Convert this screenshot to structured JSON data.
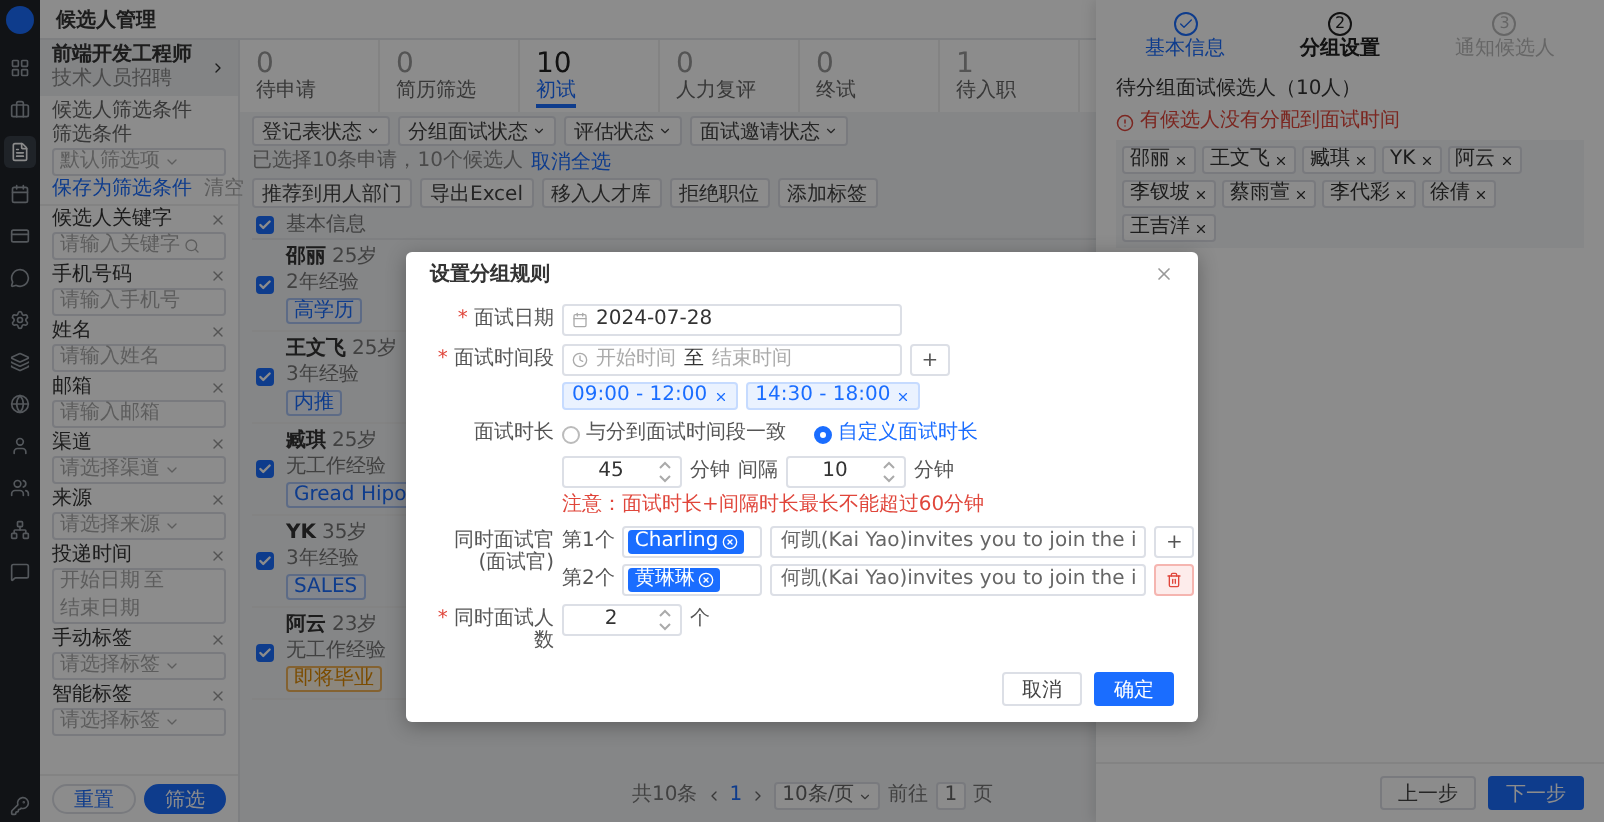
{
  "app": {
    "title": "候选人管理"
  },
  "nav_items": [
    {
      "selected": false
    },
    {
      "selected": false
    },
    {
      "selected": true
    },
    {
      "selected": false
    },
    {
      "selected": false
    },
    {
      "selected": false
    },
    {
      "selected": false
    },
    {
      "selected": false
    },
    {
      "selected": false
    },
    {
      "selected": false
    },
    {
      "selected": false
    },
    {
      "selected": false
    },
    {
      "selected": false
    }
  ],
  "position": {
    "title": "前端开发工程师",
    "subtitle": "技术人员招聘"
  },
  "filters": {
    "section_title": "候选人筛选条件",
    "preset_label": "筛选条件",
    "preset_value": "默认筛选项",
    "save_link": "保存为筛选条件",
    "clear_link": "清空",
    "groups": [
      {
        "label": "候选人关键字",
        "kind": "search",
        "placeholder": "请输入关键字"
      },
      {
        "label": "手机号码",
        "kind": "text",
        "placeholder": "请输入手机号"
      },
      {
        "label": "姓名",
        "kind": "text",
        "placeholder": "请输入姓名"
      },
      {
        "label": "邮箱",
        "kind": "text",
        "placeholder": "请输入邮箱"
      },
      {
        "label": "渠道",
        "kind": "select",
        "placeholder": "请选择渠道"
      },
      {
        "label": "来源",
        "kind": "select",
        "placeholder": "请选择来源"
      },
      {
        "label": "投递时间",
        "kind": "daterange",
        "placeholder": "开始日期",
        "separator": "至",
        "end_placeholder": "结束日期"
      },
      {
        "label": "手动标签",
        "kind": "select",
        "placeholder": "请选择标签"
      },
      {
        "label": "智能标签",
        "kind": "select",
        "placeholder": "请选择标签"
      }
    ],
    "reset": "重置",
    "apply": "筛选"
  },
  "stages": [
    {
      "count": "0",
      "label": "待申请",
      "selected": false
    },
    {
      "count": "0",
      "label": "简历筛选",
      "selected": false
    },
    {
      "count": "10",
      "label": "初试",
      "selected": true
    },
    {
      "count": "0",
      "label": "人力复评",
      "selected": false
    },
    {
      "count": "0",
      "label": "终试",
      "selected": false
    },
    {
      "count": "1",
      "label": "待入职",
      "selected": false
    }
  ],
  "dropdown_filters": [
    "登记表状态",
    "分组面试状态",
    "评估状态",
    "面试邀请状态"
  ],
  "selection_info": {
    "text": "已选择10条申请，10个候选人",
    "link": "取消全选"
  },
  "actions": [
    "推荐到用人部门",
    "导出Excel",
    "移入人才库",
    "拒绝职位",
    "添加标签"
  ],
  "list_header": {
    "checked": true,
    "label": "基本信息"
  },
  "candidates": [
    {
      "name": "邵丽",
      "age": "25岁",
      "experience": "2年经验",
      "checked": true,
      "tag": {
        "text": "高学历",
        "kind": "normal"
      }
    },
    {
      "name": "王文飞",
      "age": "25岁",
      "experience": "3年经验",
      "checked": true,
      "tag": {
        "text": "内推",
        "kind": "normal"
      }
    },
    {
      "name": "臧琪",
      "age": "25岁",
      "experience": "无工作经验",
      "checked": true,
      "tag": {
        "text": "Gread Hipo",
        "kind": "normal"
      }
    },
    {
      "name": "YK",
      "age": "35岁",
      "experience": "3年经验",
      "checked": true,
      "tag": {
        "text": "SALES",
        "kind": "normal"
      }
    },
    {
      "name": "阿云",
      "age": "23岁",
      "experience": "无工作经验",
      "checked": true,
      "tag": {
        "text": "即将毕业",
        "kind": "warning"
      }
    }
  ],
  "pagination": {
    "total": "共10条",
    "current": "1",
    "page_size": "10条/页",
    "goto_label": "前往",
    "goto_value": "1",
    "page_unit": "页"
  },
  "drawer": {
    "steps": [
      {
        "label": "基本信息",
        "completed": true,
        "selected": false
      },
      {
        "label": "分组设置",
        "completed": false,
        "selected": true,
        "number": "2"
      },
      {
        "label": "通知候选人",
        "completed": false,
        "selected": false,
        "number": "3"
      }
    ],
    "title": "待分组面试候选人（10人）",
    "warning": "有候选人没有分配到面试时间",
    "selected_candidates": [
      "邵丽",
      "王文飞",
      "臧琪",
      "YK",
      "阿云",
      "李钗坡",
      "蔡雨萱",
      "李代彩",
      "徐倩",
      "王吉洋"
    ],
    "prev_button": "上一步",
    "next_button": "下一步"
  },
  "modal": {
    "title": "设置分组规则",
    "date": {
      "label": "面试日期",
      "required_mark": "*",
      "value": "2024-07-28"
    },
    "time_range": {
      "label": "面试时间段",
      "required_mark": "*",
      "start_placeholder": "开始时间",
      "separator": "至",
      "end_placeholder": "结束时间",
      "add_button": "+",
      "slots": [
        "09:00 - 12:00",
        "14:30 - 18:00"
      ]
    },
    "duration": {
      "label": "面试时长",
      "options": [
        {
          "label": "与分到面试时间段一致",
          "selected": false
        },
        {
          "label": "自定义面试时长",
          "selected": true
        }
      ],
      "minutes": "45",
      "minutes_unit": "分钟",
      "gap_label": "间隔",
      "gap": "10",
      "gap_unit": "分钟",
      "note": "注意：面试时长+间隔时长最长不能超过60分钟"
    },
    "interviewers": {
      "label": "同时面试官(面试官)",
      "rows": [
        {
          "label": "第1个",
          "person": "Charling",
          "email": "何凯(Kai Yao)invites you to join the i",
          "kind": "add",
          "action_text": "+"
        },
        {
          "label": "第2个",
          "person": "黄琳琳",
          "email": "何凯(Kai Yao)invites you to join the i",
          "kind": "delete"
        }
      ]
    },
    "headcount": {
      "label": "同时面试人数",
      "required_mark": "*",
      "value": "2",
      "unit": "个"
    },
    "cancel": "取消",
    "confirm": "确定"
  }
}
